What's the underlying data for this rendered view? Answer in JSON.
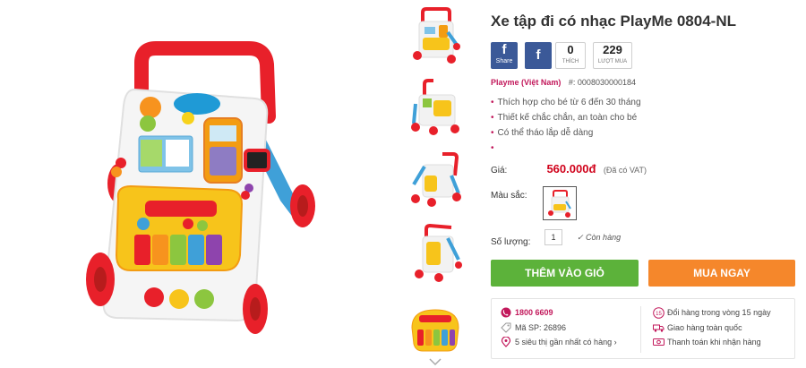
{
  "product": {
    "title": "Xe tập đi có nhạc PlayMe 0804-NL",
    "brand": "Playme (Việt Nam)",
    "code_label": "#:",
    "code": "0008030000184"
  },
  "social": {
    "share_label": "Share",
    "fb_letter": "f",
    "like_count": "0",
    "like_caption": "THÍCH",
    "buy_count": "229",
    "buy_caption": "LƯỢT MUA"
  },
  "features": [
    "Thích hợp cho bé từ 6 đến 30 tháng",
    "Thiết kế chắc chắn, an toàn cho bé",
    "Có thể tháo lắp dễ dàng",
    ""
  ],
  "price": {
    "label": "Giá:",
    "value": "560.000đ",
    "vat": "(Đã có VAT)"
  },
  "color": {
    "label": "Màu sắc:"
  },
  "quantity": {
    "label": "Số lượng:",
    "value": "1",
    "stock": "Còn hàng"
  },
  "buttons": {
    "add_to_cart": "THÊM VÀO GIỎ",
    "buy_now": "MUA NGAY"
  },
  "support": {
    "hotline": "1800 6609",
    "sku": "Mã SP: 26896",
    "stores": "5 siêu thị gần nhất có hàng",
    "returns": "Đổi hàng trong vòng 15 ngày",
    "delivery": "Giao hàng toàn quốc",
    "payment": "Thanh toán khi nhận hàng",
    "return_badge": "15"
  },
  "colors": {
    "accent": "#c2185b",
    "price": "#d0021b",
    "cart_button": "#5cb23a",
    "buy_button": "#f5872b",
    "facebook": "#3b5998"
  }
}
